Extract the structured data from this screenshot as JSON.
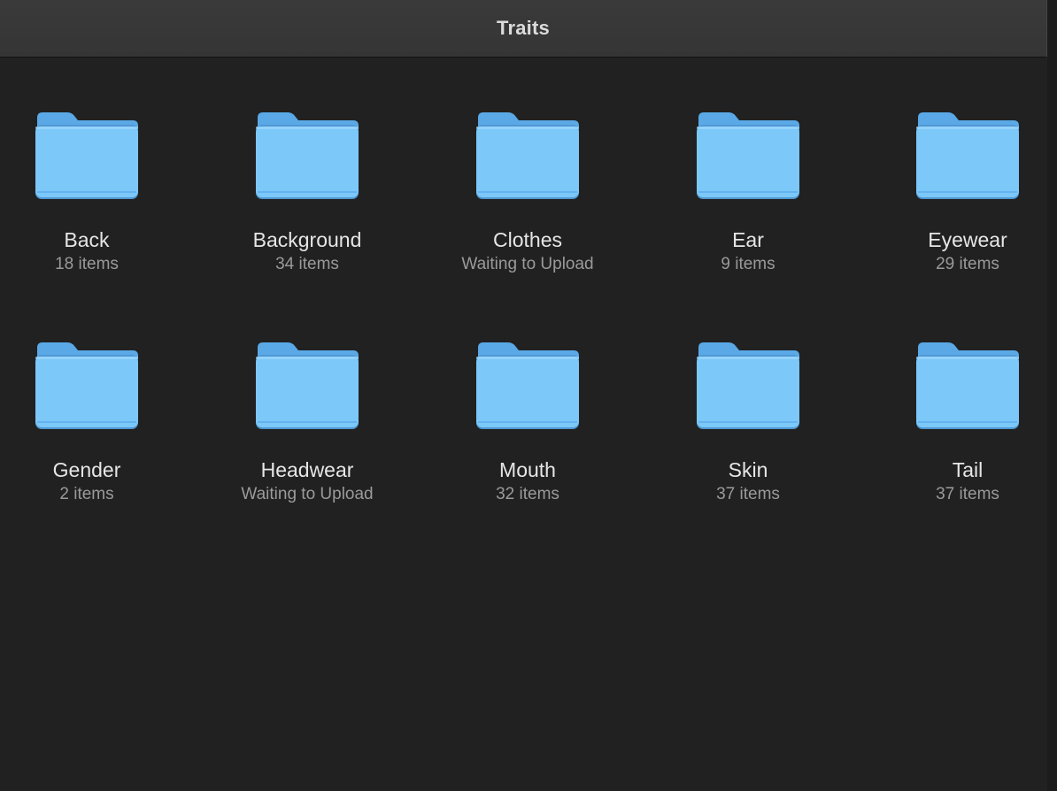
{
  "window": {
    "title": "Traits"
  },
  "folders": [
    {
      "name": "Back",
      "subtitle": "18 items",
      "icon": "folder-icon"
    },
    {
      "name": "Background",
      "subtitle": "34 items",
      "icon": "folder-icon"
    },
    {
      "name": "Clothes",
      "subtitle": "Waiting to Upload",
      "icon": "folder-icon"
    },
    {
      "name": "Ear",
      "subtitle": "9 items",
      "icon": "folder-icon"
    },
    {
      "name": "Eyewear",
      "subtitle": "29 items",
      "icon": "folder-icon"
    },
    {
      "name": "Gender",
      "subtitle": "2 items",
      "icon": "folder-icon"
    },
    {
      "name": "Headwear",
      "subtitle": "Waiting to Upload",
      "icon": "folder-icon"
    },
    {
      "name": "Mouth",
      "subtitle": "32 items",
      "icon": "folder-icon"
    },
    {
      "name": "Skin",
      "subtitle": "37 items",
      "icon": "folder-icon"
    },
    {
      "name": "Tail",
      "subtitle": "37 items",
      "icon": "folder-icon"
    }
  ],
  "colors": {
    "background": "#212121",
    "titlebar": "#383838",
    "folder_front": "#7cc8f8",
    "folder_back": "#5aa9e6"
  }
}
